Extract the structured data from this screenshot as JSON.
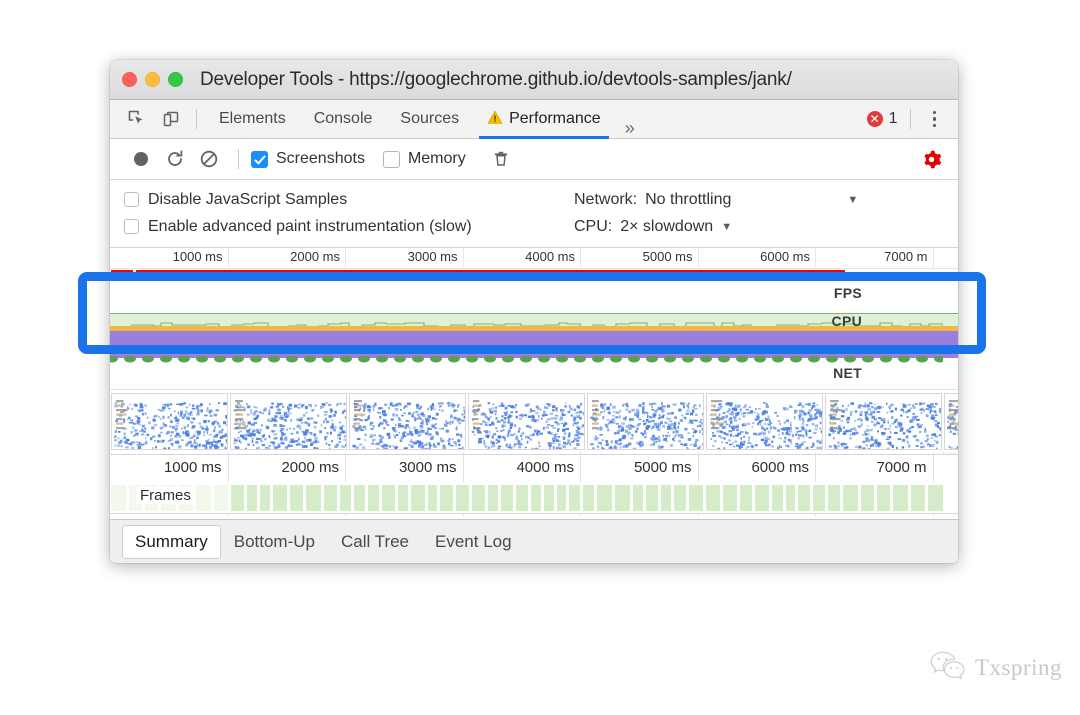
{
  "window": {
    "title": "Developer Tools - https://googlechrome.github.io/devtools-samples/jank/",
    "traffic_lights": [
      "close-red",
      "minimize-yellow",
      "zoom-green"
    ]
  },
  "tabbar": {
    "inspect_icon": "inspect-element-icon",
    "device_icon": "device-toolbar-icon",
    "tabs": [
      {
        "label": "Elements",
        "active": false,
        "warning": false
      },
      {
        "label": "Console",
        "active": false,
        "warning": false
      },
      {
        "label": "Sources",
        "active": false,
        "warning": false
      },
      {
        "label": "Performance",
        "active": true,
        "warning": true,
        "warning_glyph": "⚠"
      }
    ],
    "more_glyph": "»",
    "error_count": "1",
    "error_icon": "error-badge-icon",
    "menu_icon": "kebab-menu-icon"
  },
  "record_toolbar": {
    "record_icon": "record-circle-icon",
    "reload_icon": "reload-record-icon",
    "clear_icon": "clear-icon",
    "screenshots_label": "Screenshots",
    "screenshots_checked": true,
    "memory_label": "Memory",
    "memory_checked": false,
    "trash_icon": "trash-icon",
    "settings_icon": "gear-icon",
    "settings_color": "#e00000"
  },
  "capture_settings": {
    "disable_js_samples_label": "Disable JavaScript Samples",
    "disable_js_samples_checked": false,
    "advanced_paint_label": "Enable advanced paint instrumentation (slow)",
    "advanced_paint_checked": false,
    "network_label": "Network:",
    "network_value": "No throttling",
    "cpu_label": "CPU:",
    "cpu_value": "2× slowdown",
    "caret_glyph": "▼"
  },
  "overview": {
    "ruler_ticks": [
      "1000 ms",
      "2000 ms",
      "3000 ms",
      "4000 ms",
      "5000 ms",
      "6000 ms",
      "7000 m"
    ],
    "fps_label": "FPS",
    "cpu_label": "CPU",
    "net_label": "NET",
    "fps_bar_color": "#f40000",
    "cpu_fill_color": "#dff0d8",
    "cpu_stroke_color": "#7cb36b",
    "cpu_accent_color": "#f0b840",
    "net_color": "#9a7ee0"
  },
  "frames": {
    "ruler_ticks": [
      "1000 ms",
      "2000 ms",
      "3000 ms",
      "4000 ms",
      "5000 ms",
      "6000 ms",
      "7000 m"
    ],
    "label": "Frames",
    "chip_color": "#d6ebc8"
  },
  "bottom_tabs": [
    {
      "label": "Summary",
      "active": true
    },
    {
      "label": "Bottom-Up",
      "active": false
    },
    {
      "label": "Call Tree",
      "active": false
    },
    {
      "label": "Event Log",
      "active": false
    }
  ],
  "annotation": {
    "highlight_color": "#1a73e8",
    "target": "timeline-overview-fps-cpu"
  },
  "watermark": {
    "icon": "wechat-icon",
    "text": "Txspring"
  }
}
